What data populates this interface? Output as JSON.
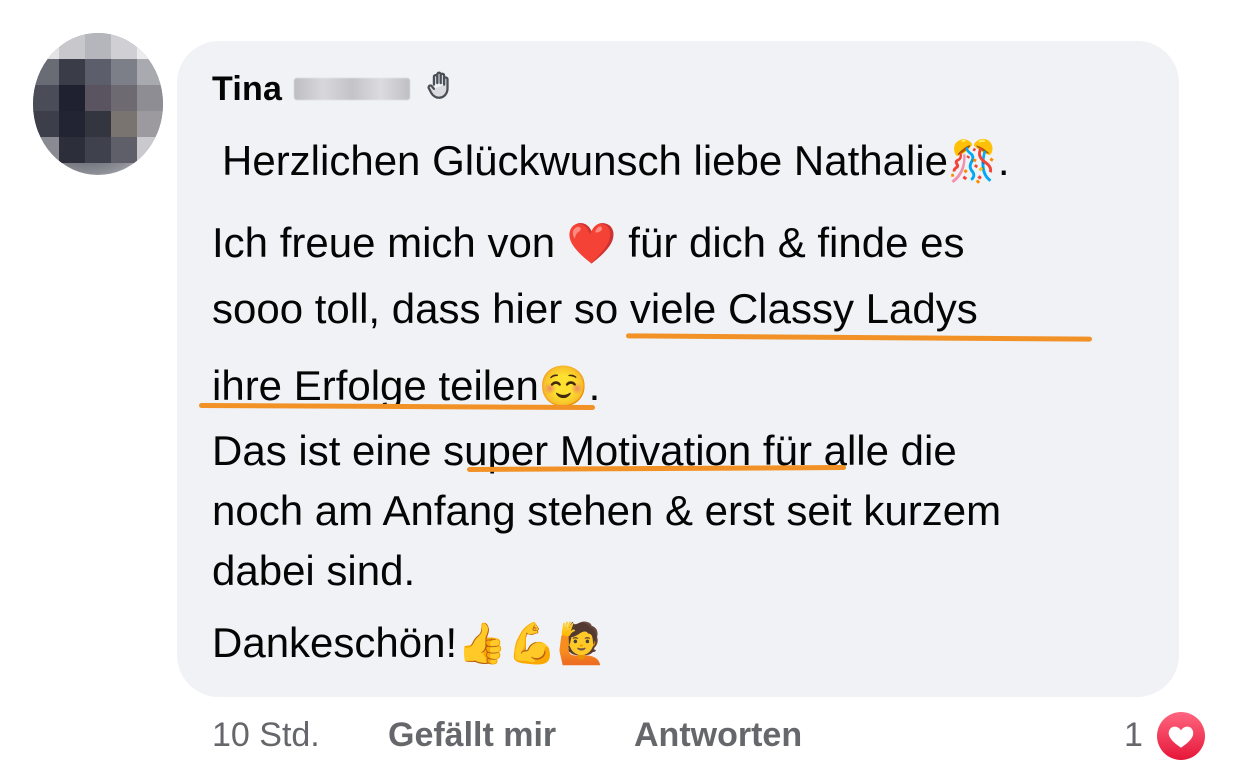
{
  "comment": {
    "author_name": "Tina",
    "author_badge_icon": "waving-hand-icon",
    "greeting_text": "Herzlichen Glückwunsch liebe Nathalie",
    "greeting_emoji": "🎊",
    "greeting_end": ".",
    "line_2a_start": "Ich freue mich von ",
    "line_2a_emoji": "❤️",
    "line_2a_end": " für dich & finde es",
    "line_2b_start": "sooo toll, dass hier ",
    "line_2b_highlight": "so viele Classy Ladys",
    "line_2c_highlight": "ihre Erfolge teilen",
    "line_2c_emoji": "☺️",
    "line_2c_end": ".",
    "line_3a_start": "Das ist eine ",
    "line_3a_highlight": "super Motivation",
    "line_3a_end": " für alle die",
    "line_3b": "noch am Anfang stehen & erst seit kurzem",
    "line_3c": "dabei sind.",
    "line_4_text": "Dankeschön!",
    "line_4_emoji": "👍💪🙋"
  },
  "actions": {
    "time": "10 Std.",
    "like_label": "Gefällt mir",
    "reply_label": "Antworten",
    "reaction_count": "1",
    "reaction_icon": "heart-icon"
  },
  "colors": {
    "bubble_bg": "#f0f2f5",
    "highlight_underline": "#f29126",
    "meta_text": "#65676b",
    "reaction_heart": "#f33e58"
  }
}
